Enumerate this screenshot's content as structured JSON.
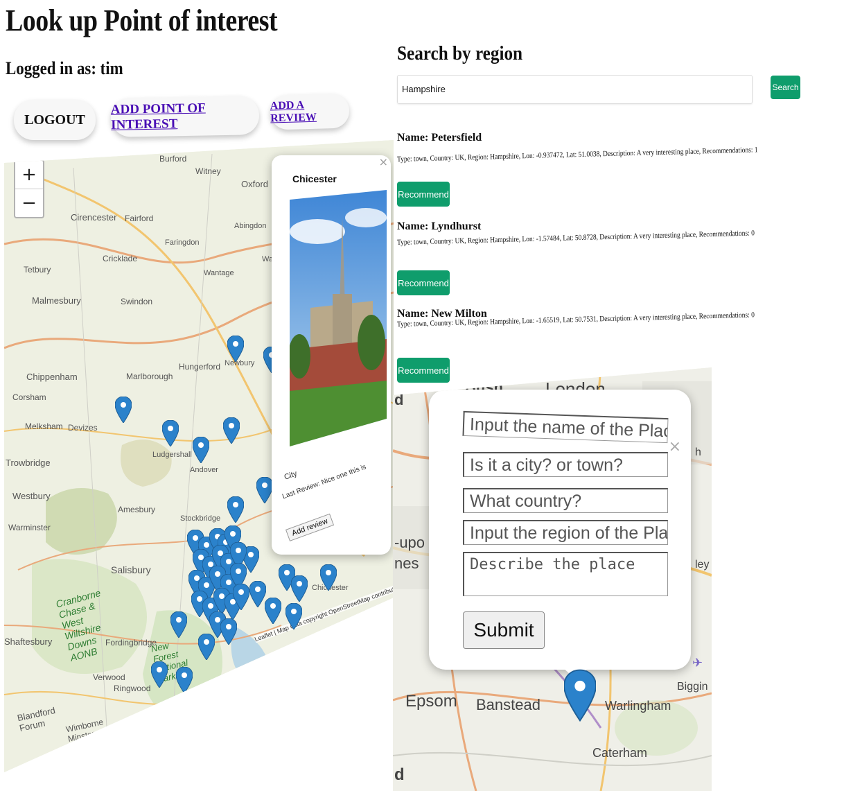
{
  "header": {
    "title": "Look up Point of interest",
    "logged_in": "Logged in as: tim"
  },
  "nav": {
    "logout": "LOGOUT",
    "add_poi": "ADD POINT OF INTEREST",
    "add_review": "ADD A REVIEW"
  },
  "map1": {
    "zoom_in": "+",
    "zoom_out": "−",
    "places": [
      "Burford",
      "Witney",
      "Oxford",
      "Cirencester",
      "Fairford",
      "Abingdon",
      "Faringdon",
      "Cricklade",
      "Tetbury",
      "Wantage",
      "Wallin",
      "Malmesbury",
      "Swindon",
      "Chippenham",
      "Corsham",
      "Marlborough",
      "Hungerford",
      "Newbury",
      "Melksham",
      "Devizes",
      "Trowbridge",
      "Ludgershall",
      "Andover",
      "Westbury",
      "Amesbury",
      "Stockbridge",
      "Warminster",
      "Salisbury",
      "Cranborne Chase & West Wiltshire Downs AONB",
      "Fordingbridge",
      "Shaftesbury",
      "New Forest National Park",
      "Verwood",
      "Ringwood",
      "Blandford Forum",
      "Wimborne Minster",
      "Chichester"
    ],
    "attribution": "Leaflet | Map data copyright OpenStreetMap contributors, Ope",
    "popup": {
      "title": "Chicester",
      "type": "City",
      "last_review": "Last Review: Nice one this is",
      "add_review": "Add review",
      "close": "×"
    }
  },
  "search": {
    "title": "Search by region",
    "value": "Hampshire",
    "button": "Search"
  },
  "results": [
    {
      "name": "Name: Petersfield",
      "desc": "Type: town, Country: UK, Region: Hampshire, Lon: -0.937472, Lat: 51.0038, Description: A very interesting place, Recommendations: 1",
      "button": "Recommend"
    },
    {
      "name": "Name: Lyndhurst",
      "desc": "Type: town, Country: UK, Region: Hampshire, Lon: -1.57484, Lat: 50.8728, Description: A very interesting place, Recommendations: 0",
      "button": "Recommend"
    },
    {
      "name": "Name: New Milton",
      "desc": "Type: town, Country: UK, Region: Hampshire, Lon: -1.65519, Lat: 50.7531, Description: A very interesting place, Recommendations: 0",
      "button": "Recommend"
    }
  ],
  "map2": {
    "places": [
      "Bush",
      "London",
      "d",
      "-upo",
      "nes",
      "Epsom",
      "Banstead",
      "Warlingham",
      "Biggin H",
      "Caterham",
      "ley",
      "h",
      "d"
    ],
    "form": {
      "name_placeholder": "Input the name of the Place",
      "type_placeholder": "Is it a city? or town?",
      "country_placeholder": "What country?",
      "region_placeholder": "Input the region of the Place",
      "desc_placeholder": "Describe the place",
      "submit": "Submit",
      "close": "×"
    }
  }
}
